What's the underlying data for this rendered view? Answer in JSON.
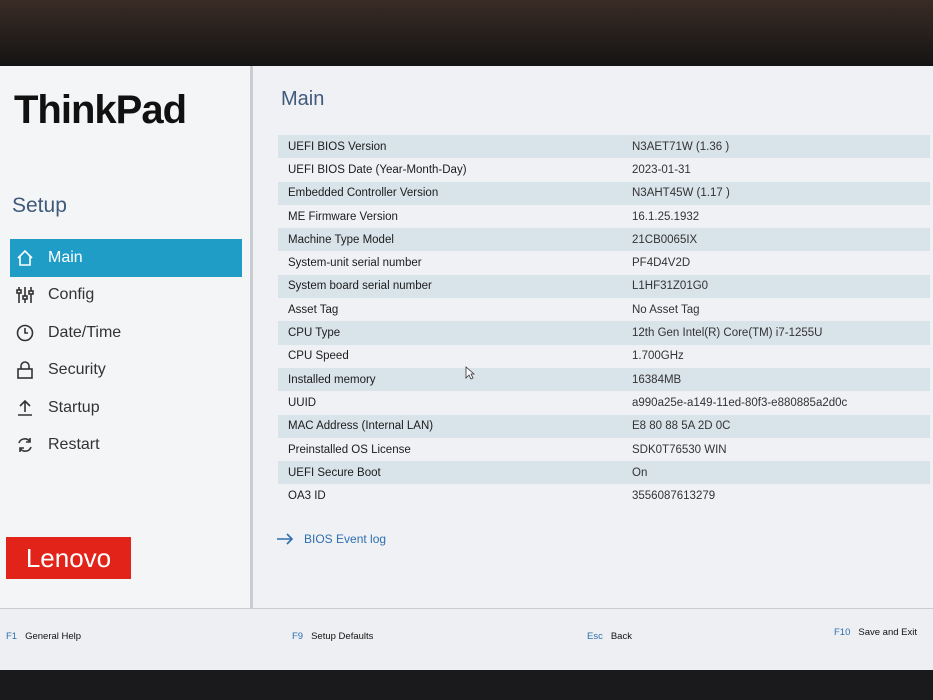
{
  "brand": {
    "thinkpad": "ThinkPad",
    "lenovo": "Lenovo"
  },
  "sidebar": {
    "title": "Setup",
    "items": [
      {
        "label": "Main",
        "icon": "home-icon",
        "active": true
      },
      {
        "label": "Config",
        "icon": "sliders-icon",
        "active": false
      },
      {
        "label": "Date/Time",
        "icon": "clock-icon",
        "active": false
      },
      {
        "label": "Security",
        "icon": "lock-icon",
        "active": false
      },
      {
        "label": "Startup",
        "icon": "upload-icon",
        "active": false
      },
      {
        "label": "Restart",
        "icon": "restart-icon",
        "active": false
      }
    ]
  },
  "main": {
    "title": "Main",
    "rows": [
      {
        "label": "UEFI BIOS Version",
        "value": "N3AET71W (1.36 )"
      },
      {
        "label": "UEFI BIOS Date (Year-Month-Day)",
        "value": "2023-01-31"
      },
      {
        "label": "Embedded Controller Version",
        "value": "N3AHT45W (1.17 )"
      },
      {
        "label": "ME Firmware Version",
        "value": "16.1.25.1932"
      },
      {
        "label": "Machine Type Model",
        "value": "21CB0065IX"
      },
      {
        "label": "System-unit serial number",
        "value": "PF4D4V2D"
      },
      {
        "label": "System board serial number",
        "value": "L1HF31Z01G0"
      },
      {
        "label": "Asset Tag",
        "value": "No Asset Tag"
      },
      {
        "label": "CPU Type",
        "value": "12th Gen Intel(R) Core(TM) i7-1255U"
      },
      {
        "label": "CPU Speed",
        "value": "1.700GHz"
      },
      {
        "label": "Installed memory",
        "value": "16384MB"
      },
      {
        "label": "UUID",
        "value": "a990a25e-a149-11ed-80f3-e880885a2d0c"
      },
      {
        "label": "MAC Address (Internal LAN)",
        "value": "E8 80 88 5A 2D 0C"
      },
      {
        "label": "Preinstalled OS License",
        "value": "SDK0T76530 WIN"
      },
      {
        "label": "UEFI Secure Boot",
        "value": "On"
      },
      {
        "label": "OA3 ID",
        "value": "3556087613279"
      }
    ],
    "event_log_label": "BIOS Event log"
  },
  "footer": {
    "keys": [
      {
        "key": "F1",
        "label": "General Help"
      },
      {
        "key": "F9",
        "label": "Setup Defaults"
      },
      {
        "key": "Esc",
        "label": "Back"
      },
      {
        "key": "F10",
        "label": "Save and Exit"
      }
    ]
  },
  "colors": {
    "accent": "#1f9dc7",
    "row_shade": "#d9e3ea",
    "title": "#3f5a7a",
    "link": "#2d6fb0",
    "lenovo_red": "#e2231a"
  }
}
